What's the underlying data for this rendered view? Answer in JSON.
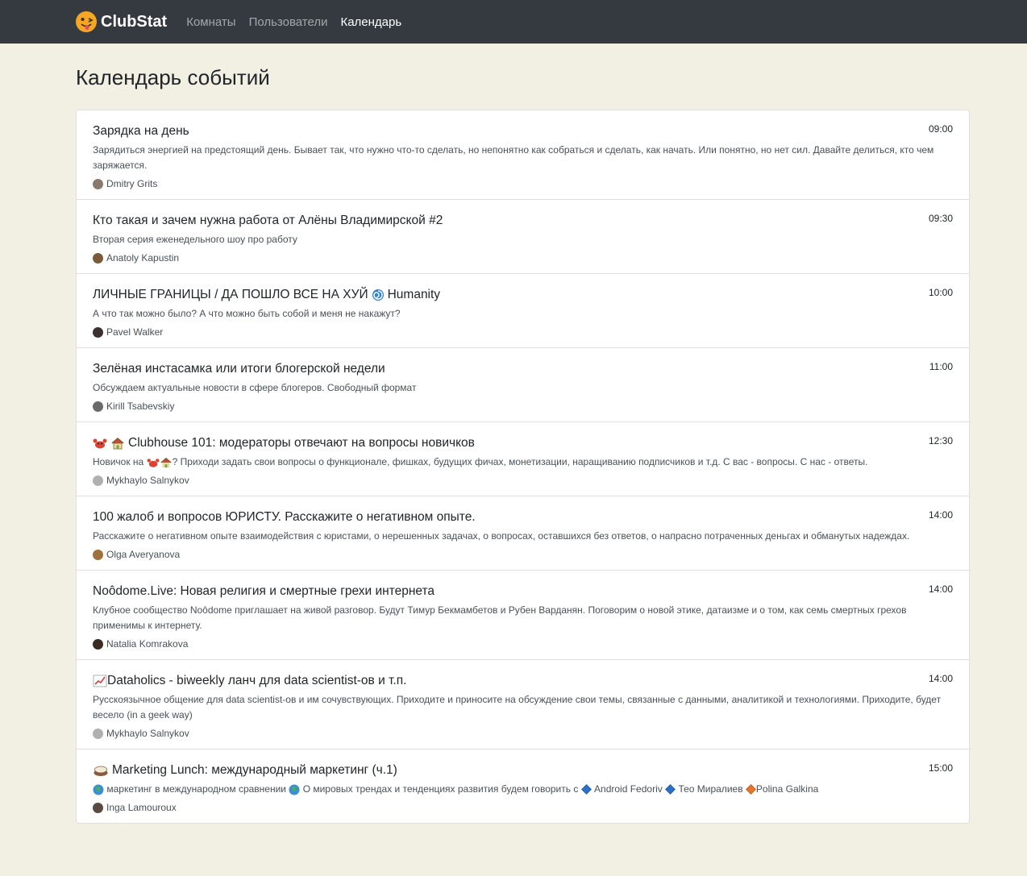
{
  "nav": {
    "brand": "ClubStat",
    "links": [
      "Комнаты",
      "Пользователи",
      "Календарь"
    ]
  },
  "page_title": "Календарь событий",
  "events": [
    {
      "title": "Зарядка на день",
      "time": "09:00",
      "description": "Зарядиться энергией на предстоящий день. Бывает так, что нужно что-то сделать, но непонятно как собраться и сделать, как начать. Или понятно, но нет сил. Давайте делиться, кто чем заряжается.",
      "author": "Dmitry Grits",
      "avatar_color": "#8a7a6e"
    },
    {
      "title": "Кто такая и зачем нужна работа от Алёны Владимирской #2",
      "time": "09:30",
      "description": "Вторая серия еженедельного шоу про работу",
      "author": "Anatoly Kapustin",
      "avatar_color": "#7a5a3a"
    },
    {
      "title": "ЛИЧНЫЕ ГРАНИЦЫ / ДА ПОШЛО ВСЕ НА ХУЙ",
      "title_suffix": "Humanity",
      "time": "10:00",
      "description": "А что так можно было? А что можно быть собой и меня не накажут?",
      "author": "Pavel Walker",
      "avatar_color": "#3a3030"
    },
    {
      "title": "Зелёная инстасамка или итоги блогерской недели",
      "time": "11:00",
      "description": "Обсуждаем актуальные новости в сфере блогеров. Свободный формат",
      "author": "Kirill Tsabevskiy",
      "avatar_color": "#6a6a6a"
    },
    {
      "title": "Clubhouse 101: модераторы отвечают на вопросы новичков",
      "time": "12:30",
      "desc_prefix": "Новичок на",
      "description": "? Приходи задать свои вопросы о функционале, фишках, будущих фичах, монетизации, наращиванию подписчиков и т.д. С вас - вопросы. С нас - ответы.",
      "author": "Mykhaylo Salnykov",
      "avatar_color": "#b0b0b0"
    },
    {
      "title": "100 жалоб и вопросов ЮРИСТУ. Расскажите о негативном опыте.",
      "time": "14:00",
      "description": "Расскажите о негативном опыте взаимодействия с юристами, о нерешенных задачах, о вопросах, оставшихся без ответов, о напрасно потраченных деньгах и обманутых надеждах.",
      "author": "Olga Averyanova",
      "avatar_color": "#a0703a"
    },
    {
      "title": "Noôdome.Live: Новая религия и смертные грехи интернета",
      "time": "14:00",
      "description": "Клубное сообщество Noôdome приглашает на живой разговор. Будут Тимур Бекмамбетов и Рубен Варданян. Поговорим о новой этике, датаизме и о том, как семь смертных грехов применимы к интернету.",
      "author": "Natalia Komrakova",
      "avatar_color": "#3a2a20"
    },
    {
      "title": "Dataholics - biweekly ланч для data scientist-ов и т.п.",
      "time": "14:00",
      "description": "Русскоязычное общение для data scientist-ов и им сочувствующих. Приходите и приносите на обсуждение свои темы, связанные с данными, аналитикой и технологиями. Приходите, будет весело (in a geek way)",
      "author": "Mykhaylo Salnykov",
      "avatar_color": "#b0b0b0"
    },
    {
      "title": "Marketing Lunch: международный маркетинг (ч.1)",
      "time": "15:00",
      "desc_parts": [
        "маркетинг в международном сравнении",
        "О мировых трендах и тенденциях развития будем говорить с",
        "Android Fedoriv",
        "Тео Миралиев",
        "Polina Galkina"
      ],
      "author": "Inga Lamouroux",
      "avatar_color": "#5a4a40"
    }
  ]
}
